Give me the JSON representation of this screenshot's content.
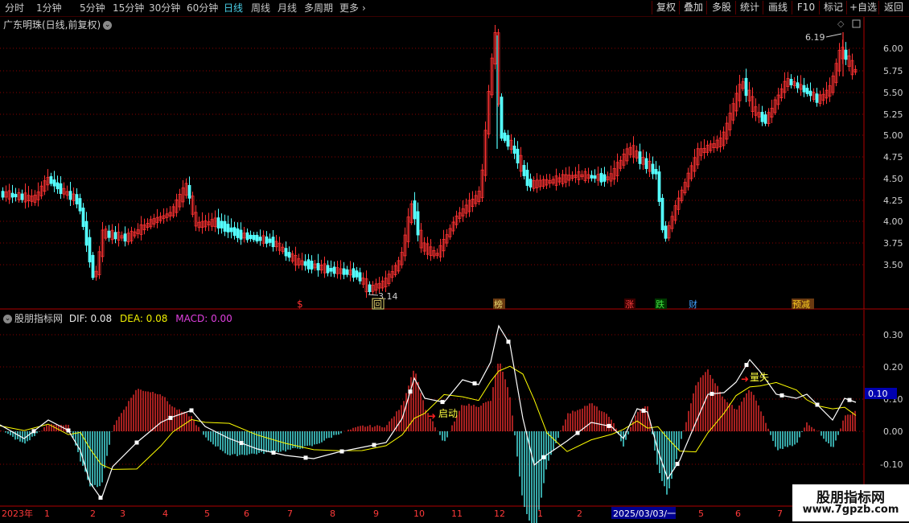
{
  "toolbar": {
    "periods": [
      "分时",
      "1分钟",
      "5分钟",
      "15分钟",
      "30分钟",
      "60分钟",
      "日线",
      "周线",
      "月线",
      "多周期",
      "更多"
    ],
    "active_period": "日线",
    "more_arrow": "chevron-right-icon",
    "right_buttons": [
      "复权",
      "叠加",
      "多股",
      "统计",
      "画线",
      "F10",
      "标记",
      "+自选",
      "返回"
    ]
  },
  "chart": {
    "title": "广东明珠(日线,前复权)",
    "title_icon": "chevron-down-icon",
    "high_label": "6.19",
    "low_label": "3.14",
    "price_ticks": [
      "6.00",
      "5.75",
      "5.50",
      "5.25",
      "5.00",
      "4.75",
      "4.50",
      "4.25",
      "4.00",
      "3.75",
      "3.50"
    ],
    "event_markers": [
      {
        "text": "$",
        "color": "#ff3030"
      },
      {
        "text": "回",
        "color": "#e8d870"
      },
      {
        "text": "榜",
        "color": "#e8d870"
      },
      {
        "text": "涨",
        "color": "#ff4040"
      },
      {
        "text": "跌",
        "color": "#40e040"
      },
      {
        "text": "财",
        "color": "#40a0ff"
      },
      {
        "text": "预减",
        "color": "#ffd020"
      }
    ]
  },
  "indicator": {
    "name": "股朋指标网",
    "dif_label": "DIF: 0.08",
    "dea_label": "DEA: 0.08",
    "macd_label": "MACD: 0.00",
    "current_value": "0.10",
    "ticks": [
      "0.30",
      "0.20",
      "0.10",
      "0.00",
      "-0.10"
    ],
    "annotations": [
      "启动",
      "量失"
    ]
  },
  "time_axis": {
    "labels": [
      "2023年",
      "1",
      "2",
      "3",
      "4",
      "5",
      "6",
      "7",
      "8",
      "9",
      "10",
      "11",
      "12",
      "1",
      "2",
      "2025/03/03/一",
      "5",
      "6",
      "7"
    ]
  },
  "watermark": {
    "line1": "股朋指标网",
    "line2": "www.7gpzb.com"
  },
  "colors": {
    "up": "#ff3232",
    "down": "#54ffff",
    "dif": "#ffffff",
    "dea": "#ffff00",
    "grid": "#b00000"
  }
}
